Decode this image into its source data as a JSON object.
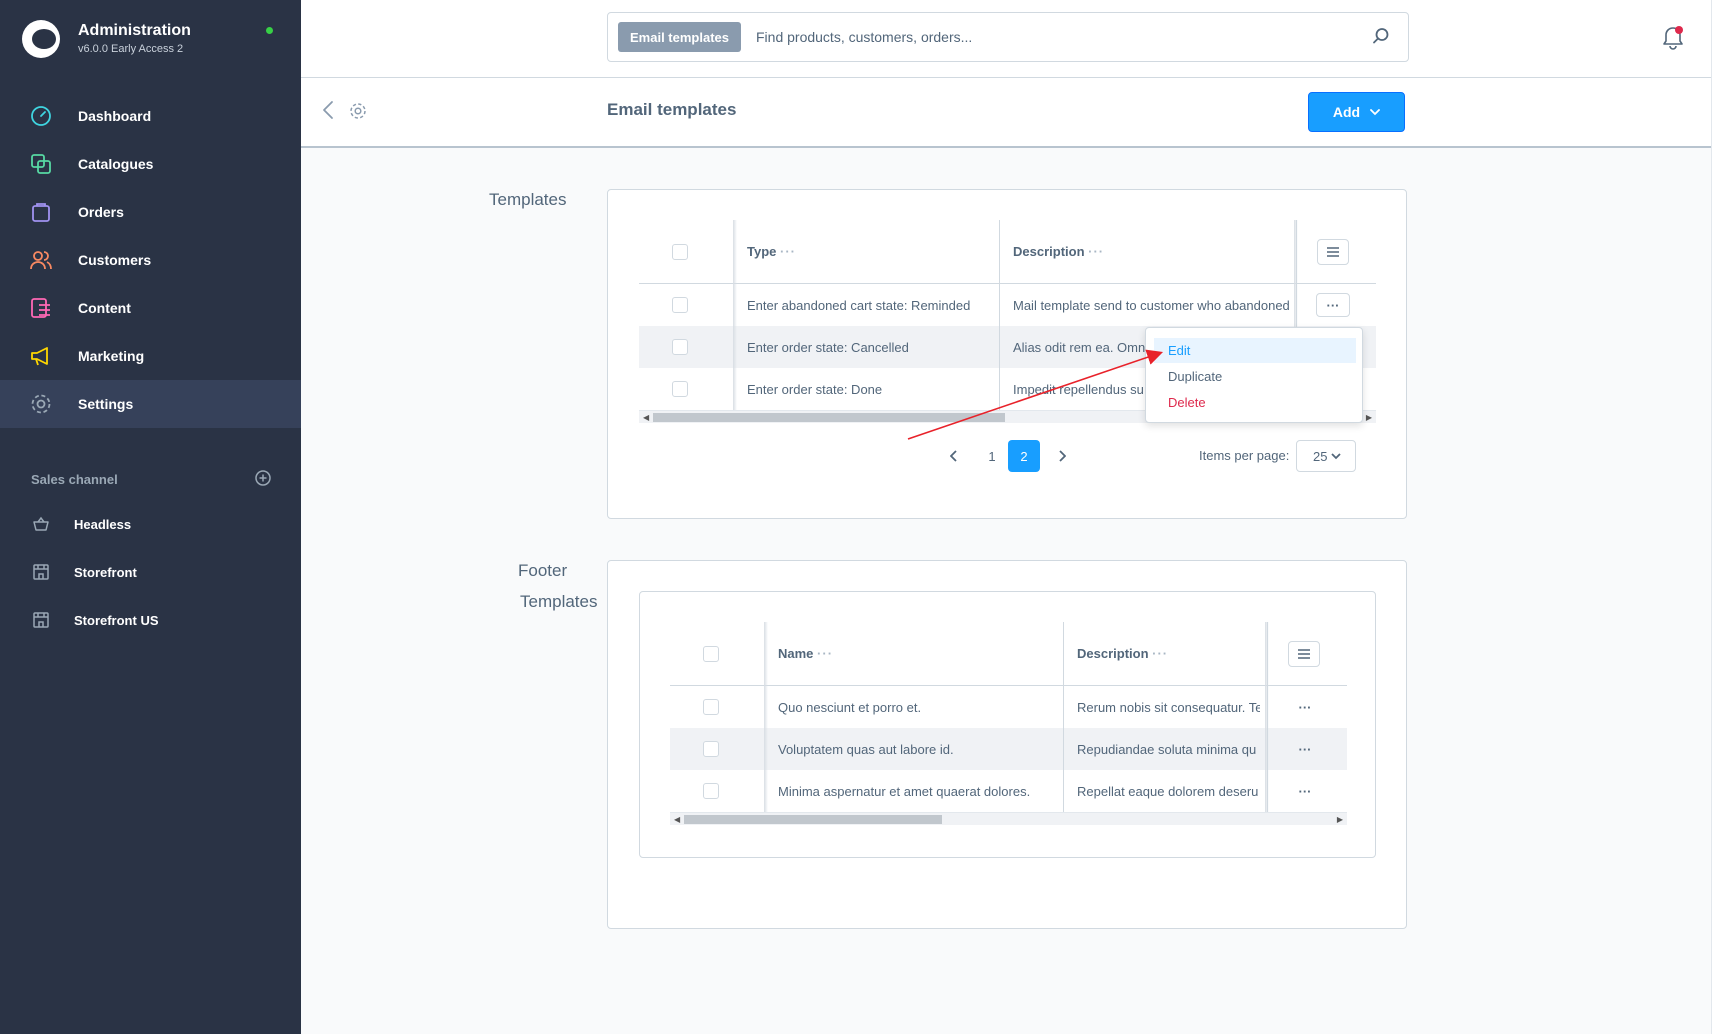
{
  "app": {
    "title": "Administration",
    "version": "v6.0.0 Early Access 2",
    "status_color": "#37d046"
  },
  "sidebar": {
    "items": [
      {
        "label": "Dashboard",
        "icon": "dashboard-icon",
        "color": "#57d9a3"
      },
      {
        "label": "Catalogues",
        "icon": "catalogues-icon",
        "color": "#57d9a3"
      },
      {
        "label": "Orders",
        "icon": "orders-icon",
        "color": "#a092f0"
      },
      {
        "label": "Customers",
        "icon": "customers-icon",
        "color": "#f88962"
      },
      {
        "label": "Content",
        "icon": "content-icon",
        "color": "#ff68b4"
      },
      {
        "label": "Marketing",
        "icon": "marketing-icon",
        "color": "#ffd700"
      },
      {
        "label": "Settings",
        "icon": "settings-icon",
        "color": "#9aa8b5",
        "active": true
      }
    ],
    "sales_channel_heading": "Sales channel",
    "sales_channels": [
      {
        "label": "Headless",
        "icon": "basket-icon"
      },
      {
        "label": "Storefront",
        "icon": "storefront-icon"
      },
      {
        "label": "Storefront US",
        "icon": "storefront-icon"
      }
    ]
  },
  "search": {
    "tag": "Email templates",
    "placeholder": "Find products, customers, orders..."
  },
  "smartbar": {
    "title": "Email templates",
    "add_label": "Add"
  },
  "templates_section": {
    "label": "Templates",
    "columns": [
      "Type",
      "Description"
    ],
    "rows": [
      {
        "type": "Enter abandoned cart state: Reminded",
        "description": "Mail template send to customer who abandoned"
      },
      {
        "type": "Enter order state: Cancelled",
        "description": "Alias odit rem ea. Omn"
      },
      {
        "type": "Enter order state: Done",
        "description": "Impedit repellendus su"
      }
    ],
    "context_menu": [
      {
        "label": "Edit",
        "state": "active"
      },
      {
        "label": "Duplicate",
        "state": "normal"
      },
      {
        "label": "Delete",
        "state": "danger"
      }
    ],
    "pagination": {
      "pages": [
        "1",
        "2"
      ],
      "current_page": "2",
      "items_per_page_label": "Items per page:",
      "items_per_page": "25"
    }
  },
  "footer_section": {
    "label_line1": "Footer",
    "label_line2": "Templates",
    "columns": [
      "Name",
      "Description"
    ],
    "rows": [
      {
        "name": "Quo nesciunt et porro et.",
        "description": "Rerum nobis sit consequatur. Te"
      },
      {
        "name": "Voluptatem quas aut labore id.",
        "description": "Repudiandae soluta minima qu"
      },
      {
        "name": "Minima aspernatur et amet quaerat dolores.",
        "description": "Repellat eaque dolorem deseru"
      }
    ]
  },
  "colors": {
    "primary": "#189eff",
    "danger": "#de294c",
    "sidebar_bg": "#2a3345",
    "annotation_arrow": "#e8222a"
  }
}
